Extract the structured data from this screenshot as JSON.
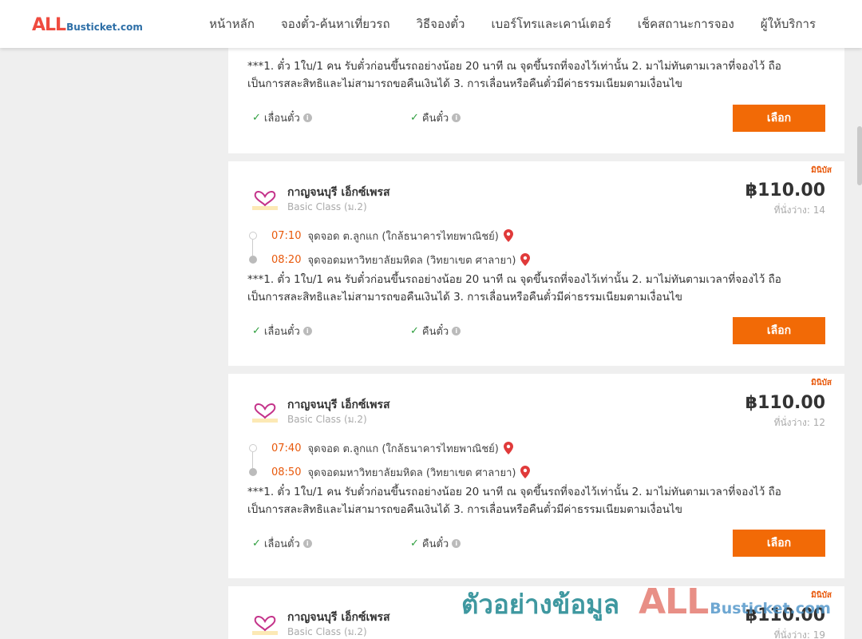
{
  "logo": {
    "all": "ALL",
    "rest": "Busticket.com"
  },
  "nav": [
    "หน้าหลัก",
    "จองตั๋ว-ค้นหาเที่ยวรถ",
    "วิธีจองตั๋ว",
    "เบอร์โทรและเคาน์เตอร์",
    "เช็คสถานะการจอง",
    "ผู้ให้บริการ"
  ],
  "common": {
    "notice_line1": "***1. ตั๋ว 1ใบ/1 คน รับตั๋วก่อนขึ้นรถอย่างน้อย 20 นาที ณ จุดขึ้นรถที่จองไว้เท่านั้น 2. มาไม่ทันตามเวลาที่จองไว้ ถือ",
    "notice_line2": "เป็นการสละสิทธิและไม่สามารถขอคืนเงินได้ 3. การเลื่อนหรือคืนตั๋วมีค่าธรรมเนียมตามเงื่อนไข",
    "reschedule": "เลื่อนตั๋ว",
    "refund": "คืนตั๋ว",
    "select": "เลือก",
    "badge": "มินิบัส",
    "operator": "กาญจนบุรี เอ็กซ์เพรส",
    "class": "Basic Class (ม.2)",
    "logo_text1": "กาญจนบุรี",
    "logo_text2": "เอ็กซ์เพรส"
  },
  "trips": [
    {
      "price": "฿110.00",
      "seats": "ที่นั่งว่าง: 14",
      "depart_time": "07:10",
      "depart_place": "จุดจอด ต.ลูกแก (ใกล้ธนาคารไทยพาณิชย์)",
      "arrive_time": "08:20",
      "arrive_place": "จุดจอดมหาวิทยาลัยมหิดล (วิทยาเขต ศาลายา)"
    },
    {
      "price": "฿110.00",
      "seats": "ที่นั่งว่าง: 12",
      "depart_time": "07:40",
      "depart_place": "จุดจอด ต.ลูกแก (ใกล้ธนาคารไทยพาณิชย์)",
      "arrive_time": "08:50",
      "arrive_place": "จุดจอดมหาวิทยาลัยมหิดล (วิทยาเขต ศาลายา)"
    },
    {
      "price": "฿110.00",
      "seats": "ที่นั่งว่าง: 19"
    }
  ],
  "watermark": {
    "text": "ตัวอย่างข้อมูล",
    "all": "ALL",
    "rest": "Busticket.com"
  }
}
